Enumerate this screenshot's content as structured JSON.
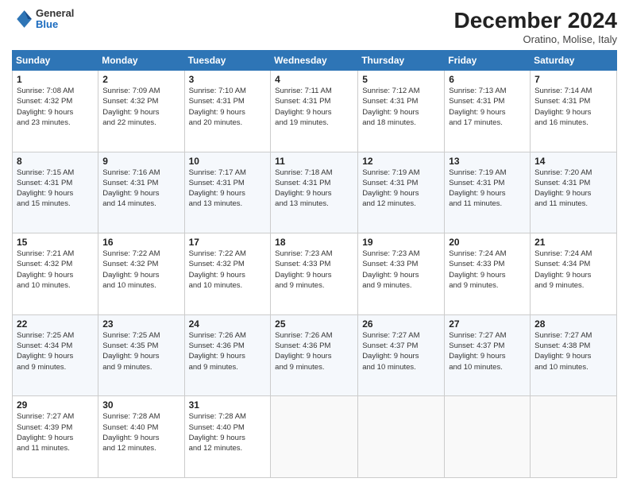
{
  "logo": {
    "general": "General",
    "blue": "Blue"
  },
  "title": {
    "month": "December 2024",
    "location": "Oratino, Molise, Italy"
  },
  "days_of_week": [
    "Sunday",
    "Monday",
    "Tuesday",
    "Wednesday",
    "Thursday",
    "Friday",
    "Saturday"
  ],
  "weeks": [
    [
      {
        "day": "1",
        "info": "Sunrise: 7:08 AM\nSunset: 4:32 PM\nDaylight: 9 hours\nand 23 minutes."
      },
      {
        "day": "2",
        "info": "Sunrise: 7:09 AM\nSunset: 4:32 PM\nDaylight: 9 hours\nand 22 minutes."
      },
      {
        "day": "3",
        "info": "Sunrise: 7:10 AM\nSunset: 4:31 PM\nDaylight: 9 hours\nand 20 minutes."
      },
      {
        "day": "4",
        "info": "Sunrise: 7:11 AM\nSunset: 4:31 PM\nDaylight: 9 hours\nand 19 minutes."
      },
      {
        "day": "5",
        "info": "Sunrise: 7:12 AM\nSunset: 4:31 PM\nDaylight: 9 hours\nand 18 minutes."
      },
      {
        "day": "6",
        "info": "Sunrise: 7:13 AM\nSunset: 4:31 PM\nDaylight: 9 hours\nand 17 minutes."
      },
      {
        "day": "7",
        "info": "Sunrise: 7:14 AM\nSunset: 4:31 PM\nDaylight: 9 hours\nand 16 minutes."
      }
    ],
    [
      {
        "day": "8",
        "info": "Sunrise: 7:15 AM\nSunset: 4:31 PM\nDaylight: 9 hours\nand 15 minutes."
      },
      {
        "day": "9",
        "info": "Sunrise: 7:16 AM\nSunset: 4:31 PM\nDaylight: 9 hours\nand 14 minutes."
      },
      {
        "day": "10",
        "info": "Sunrise: 7:17 AM\nSunset: 4:31 PM\nDaylight: 9 hours\nand 13 minutes."
      },
      {
        "day": "11",
        "info": "Sunrise: 7:18 AM\nSunset: 4:31 PM\nDaylight: 9 hours\nand 13 minutes."
      },
      {
        "day": "12",
        "info": "Sunrise: 7:19 AM\nSunset: 4:31 PM\nDaylight: 9 hours\nand 12 minutes."
      },
      {
        "day": "13",
        "info": "Sunrise: 7:19 AM\nSunset: 4:31 PM\nDaylight: 9 hours\nand 11 minutes."
      },
      {
        "day": "14",
        "info": "Sunrise: 7:20 AM\nSunset: 4:31 PM\nDaylight: 9 hours\nand 11 minutes."
      }
    ],
    [
      {
        "day": "15",
        "info": "Sunrise: 7:21 AM\nSunset: 4:32 PM\nDaylight: 9 hours\nand 10 minutes."
      },
      {
        "day": "16",
        "info": "Sunrise: 7:22 AM\nSunset: 4:32 PM\nDaylight: 9 hours\nand 10 minutes."
      },
      {
        "day": "17",
        "info": "Sunrise: 7:22 AM\nSunset: 4:32 PM\nDaylight: 9 hours\nand 10 minutes."
      },
      {
        "day": "18",
        "info": "Sunrise: 7:23 AM\nSunset: 4:33 PM\nDaylight: 9 hours\nand 9 minutes."
      },
      {
        "day": "19",
        "info": "Sunrise: 7:23 AM\nSunset: 4:33 PM\nDaylight: 9 hours\nand 9 minutes."
      },
      {
        "day": "20",
        "info": "Sunrise: 7:24 AM\nSunset: 4:33 PM\nDaylight: 9 hours\nand 9 minutes."
      },
      {
        "day": "21",
        "info": "Sunrise: 7:24 AM\nSunset: 4:34 PM\nDaylight: 9 hours\nand 9 minutes."
      }
    ],
    [
      {
        "day": "22",
        "info": "Sunrise: 7:25 AM\nSunset: 4:34 PM\nDaylight: 9 hours\nand 9 minutes."
      },
      {
        "day": "23",
        "info": "Sunrise: 7:25 AM\nSunset: 4:35 PM\nDaylight: 9 hours\nand 9 minutes."
      },
      {
        "day": "24",
        "info": "Sunrise: 7:26 AM\nSunset: 4:36 PM\nDaylight: 9 hours\nand 9 minutes."
      },
      {
        "day": "25",
        "info": "Sunrise: 7:26 AM\nSunset: 4:36 PM\nDaylight: 9 hours\nand 9 minutes."
      },
      {
        "day": "26",
        "info": "Sunrise: 7:27 AM\nSunset: 4:37 PM\nDaylight: 9 hours\nand 10 minutes."
      },
      {
        "day": "27",
        "info": "Sunrise: 7:27 AM\nSunset: 4:37 PM\nDaylight: 9 hours\nand 10 minutes."
      },
      {
        "day": "28",
        "info": "Sunrise: 7:27 AM\nSunset: 4:38 PM\nDaylight: 9 hours\nand 10 minutes."
      }
    ],
    [
      {
        "day": "29",
        "info": "Sunrise: 7:27 AM\nSunset: 4:39 PM\nDaylight: 9 hours\nand 11 minutes."
      },
      {
        "day": "30",
        "info": "Sunrise: 7:28 AM\nSunset: 4:40 PM\nDaylight: 9 hours\nand 12 minutes."
      },
      {
        "day": "31",
        "info": "Sunrise: 7:28 AM\nSunset: 4:40 PM\nDaylight: 9 hours\nand 12 minutes."
      },
      {
        "day": "",
        "info": ""
      },
      {
        "day": "",
        "info": ""
      },
      {
        "day": "",
        "info": ""
      },
      {
        "day": "",
        "info": ""
      }
    ]
  ]
}
